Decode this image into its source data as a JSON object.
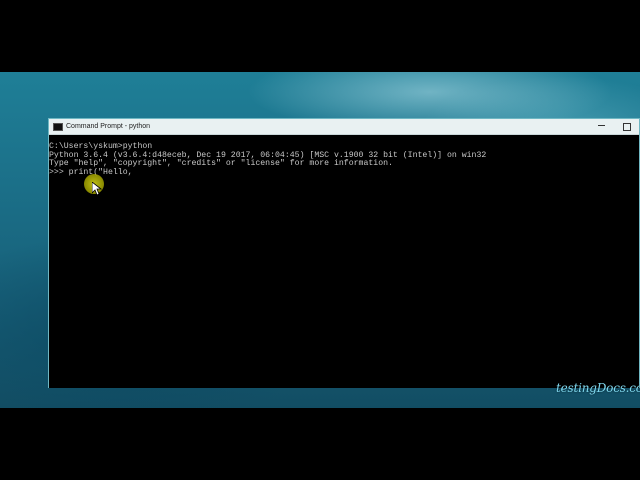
{
  "window": {
    "title": "Command Prompt - python",
    "minimize_label": "",
    "maximize_label": ""
  },
  "console": {
    "lines": [
      "C:\\Users\\yskum>python",
      "Python 3.6.4 (v3.6.4:d48eceb, Dec 19 2017, 06:04:45) [MSC v.1900 32 bit (Intel)] on win32",
      "Type \"help\", \"copyright\", \"credits\" or \"license\" for more information.",
      ">>> print(\"Hello,"
    ]
  },
  "watermark": {
    "text": "testingDocs.com"
  },
  "colors": {
    "console_bg": "#000000",
    "console_text": "#c8c8c8",
    "titlebar_bg": "#e9f1f2",
    "desktop_teal": "#1f7f97",
    "cursor_highlight": "#c8c814"
  },
  "icons": {
    "window_icon": "command-prompt-icon",
    "cursor": "mouse-pointer-icon"
  }
}
